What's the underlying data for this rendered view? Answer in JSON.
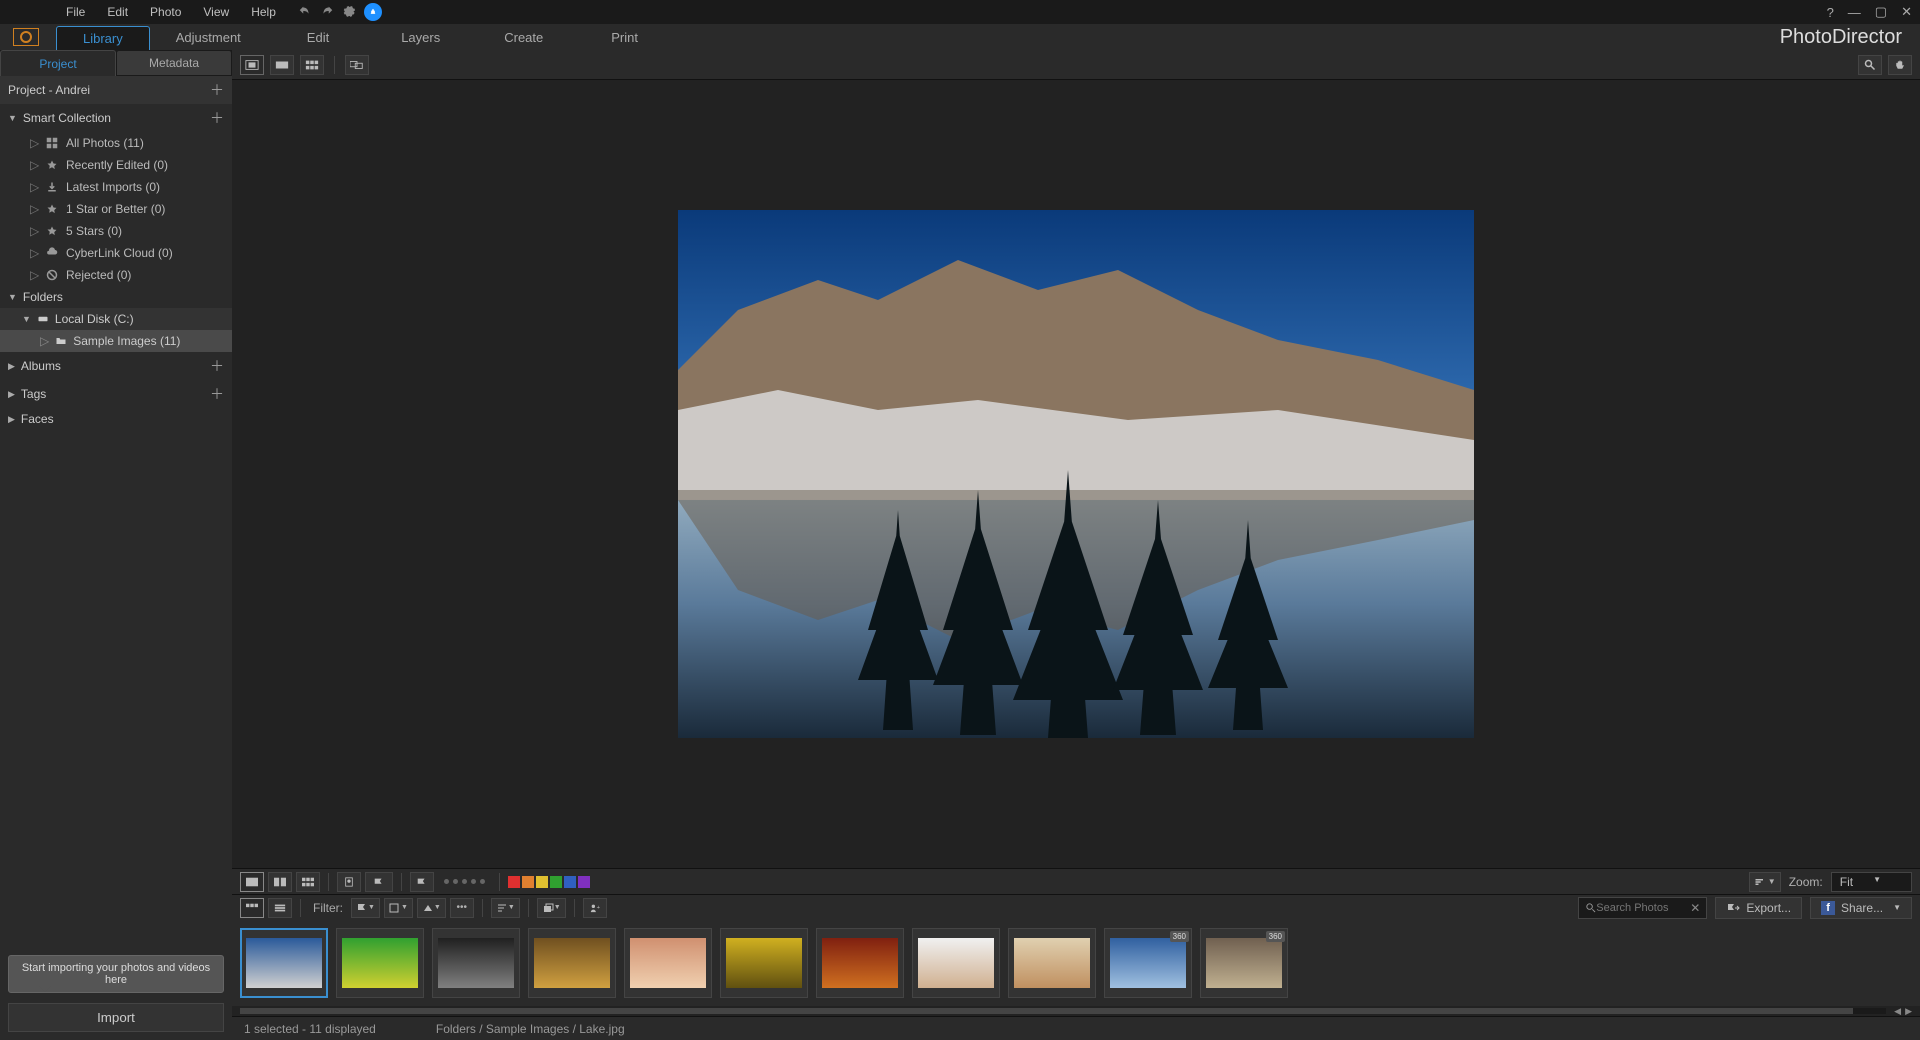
{
  "menubar": {
    "items": [
      "File",
      "Edit",
      "Photo",
      "View",
      "Help"
    ]
  },
  "app": {
    "name": "PhotoDirector"
  },
  "modules": {
    "items": [
      "Library",
      "Adjustment",
      "Edit",
      "Layers",
      "Create",
      "Print"
    ],
    "active": 0
  },
  "panel_tabs": {
    "items": [
      "Project",
      "Metadata"
    ],
    "active": 0
  },
  "project": {
    "header": "Project - Andrei",
    "smart_collection": {
      "label": "Smart Collection",
      "items": [
        "All Photos (11)",
        "Recently Edited (0)",
        "Latest Imports (0)",
        "1 Star or Better (0)",
        "5 Stars (0)",
        "CyberLink Cloud (0)",
        "Rejected (0)"
      ]
    },
    "folders": {
      "label": "Folders",
      "disk": "Local Disk (C:)",
      "folder": "Sample Images (11)"
    },
    "albums": "Albums",
    "tags": "Tags",
    "faces": "Faces"
  },
  "sidebar": {
    "tip": "Start importing your photos and videos here",
    "import_btn": "Import"
  },
  "filmstrip": {
    "filter_label": "Filter:",
    "zoom_label": "Zoom:",
    "zoom_value": "Fit",
    "search_placeholder": "Search Photos",
    "export_label": "Export...",
    "share_label": "Share...",
    "colors": [
      "#e03030",
      "#e08030",
      "#e0c030",
      "#30a030",
      "#3060c0",
      "#8030c0"
    ],
    "thumbs": [
      {
        "selected": true,
        "badge": ""
      },
      {
        "selected": false,
        "badge": ""
      },
      {
        "selected": false,
        "badge": ""
      },
      {
        "selected": false,
        "badge": ""
      },
      {
        "selected": false,
        "badge": ""
      },
      {
        "selected": false,
        "badge": ""
      },
      {
        "selected": false,
        "badge": ""
      },
      {
        "selected": false,
        "badge": ""
      },
      {
        "selected": false,
        "badge": ""
      },
      {
        "selected": false,
        "badge": "360"
      },
      {
        "selected": false,
        "badge": "360"
      }
    ]
  },
  "status": {
    "selection": "1 selected - 11 displayed",
    "path": "Folders / Sample Images / Lake.jpg"
  }
}
